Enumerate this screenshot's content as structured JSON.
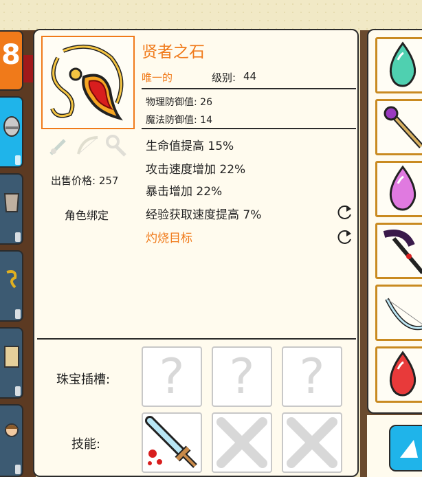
{
  "item": {
    "name": "贤者之石",
    "rarity": "唯一的",
    "level_label": "级别:",
    "level_value": "44",
    "physical_defense": "物理防御值: 26",
    "magic_defense": "魔法防御值: 14",
    "sell_price": "出售价格: 257",
    "binding": "角色绑定",
    "icon": "amulet-necklace-icon"
  },
  "stats": [
    {
      "label": "生命值提高 15%",
      "rerollable": false
    },
    {
      "label": "攻击速度增加 22%",
      "rerollable": false
    },
    {
      "label": "暴击增加 22%",
      "rerollable": false
    },
    {
      "label": "经验获取速度提高 7%",
      "rerollable": true
    },
    {
      "label": "灼烧目标",
      "rerollable": true
    }
  ],
  "sockets": {
    "label": "珠宝插槽:",
    "slots": [
      "?",
      "?",
      "?"
    ]
  },
  "skills": {
    "label": "技能:",
    "slots": [
      "bleeding-sword-icon",
      "locked-x-icon",
      "locked-x-icon"
    ]
  },
  "left_tabs": {
    "top_number": "8",
    "tabs": [
      "helmet-icon",
      "armor-icon",
      "rune-icon",
      "scroll-icon",
      "hero-portrait-icon"
    ]
  },
  "inventory": [
    "teal-gem-icon",
    "magic-staff-icon",
    "pink-gem-icon",
    "dark-scythe-icon",
    "ice-bow-icon",
    "red-gem-icon"
  ],
  "colors": {
    "accent_orange": "#f07a1a",
    "accent_blue": "#1fb4ea",
    "panel_bg": "#fffbee",
    "inventory_border": "#c98a20"
  }
}
